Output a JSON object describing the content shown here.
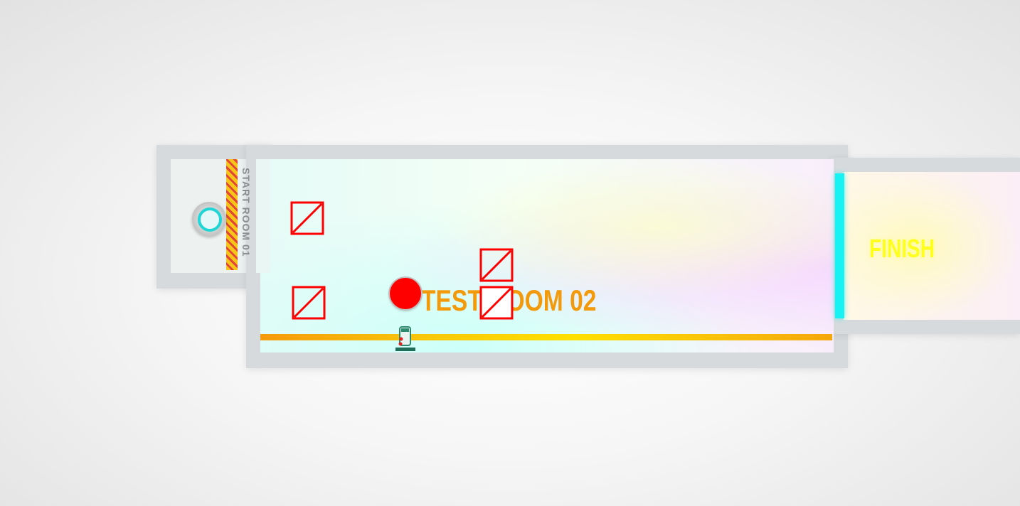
{
  "rooms": {
    "start_room_label": "START ROOM 01",
    "test_room_label": "TEST ROOM 02",
    "finish_label": "FINISH"
  },
  "colors": {
    "floor_accent": "#f39a0c",
    "finish_text": "#ffff1e",
    "exit_gate": "#19f2f2",
    "hazard_box": "#ff0000",
    "ball": "#ff0000",
    "wall": "#d7dadd"
  },
  "objects": {
    "crates": 4,
    "ball_color": "red",
    "portal_color": "cyan"
  }
}
